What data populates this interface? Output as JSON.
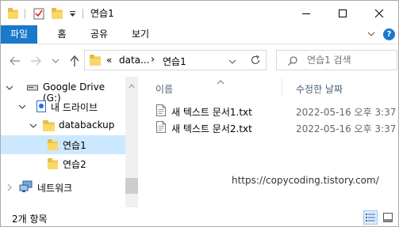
{
  "window": {
    "title": "연습1"
  },
  "ribbon": {
    "tabs": [
      "파일",
      "홈",
      "공유",
      "보기"
    ]
  },
  "address": {
    "parts": [
      "«",
      "data...",
      "›",
      "연습1"
    ]
  },
  "search": {
    "placeholder": "연습1 검색"
  },
  "nav": {
    "items": [
      {
        "label": "Google Drive (G:)",
        "icon": "drive-icon",
        "selected": false
      },
      {
        "label": "내 드라이브",
        "icon": "gdrive-icon",
        "selected": false
      },
      {
        "label": "databackup",
        "icon": "folder-icon",
        "selected": false
      },
      {
        "label": "연습1",
        "icon": "folder-icon",
        "selected": true
      },
      {
        "label": "연습2",
        "icon": "folder-icon",
        "selected": false
      },
      {
        "label": "네트워크",
        "icon": "network-icon",
        "selected": false
      }
    ]
  },
  "columns": {
    "name": "이름",
    "modified": "수정한 날짜"
  },
  "files": [
    {
      "name": "새 텍스트 문서1.txt",
      "modified": "2022-05-16 오후 3:37"
    },
    {
      "name": "새 텍스트 문서2.txt",
      "modified": "2022-05-16 오후 3:37"
    }
  ],
  "watermark": "https://copycoding.tistory.com/",
  "status": {
    "count_text": "2개 항목"
  },
  "colors": {
    "accent": "#1979ca",
    "selection": "#cce8ff",
    "folder": "#f8d775"
  }
}
